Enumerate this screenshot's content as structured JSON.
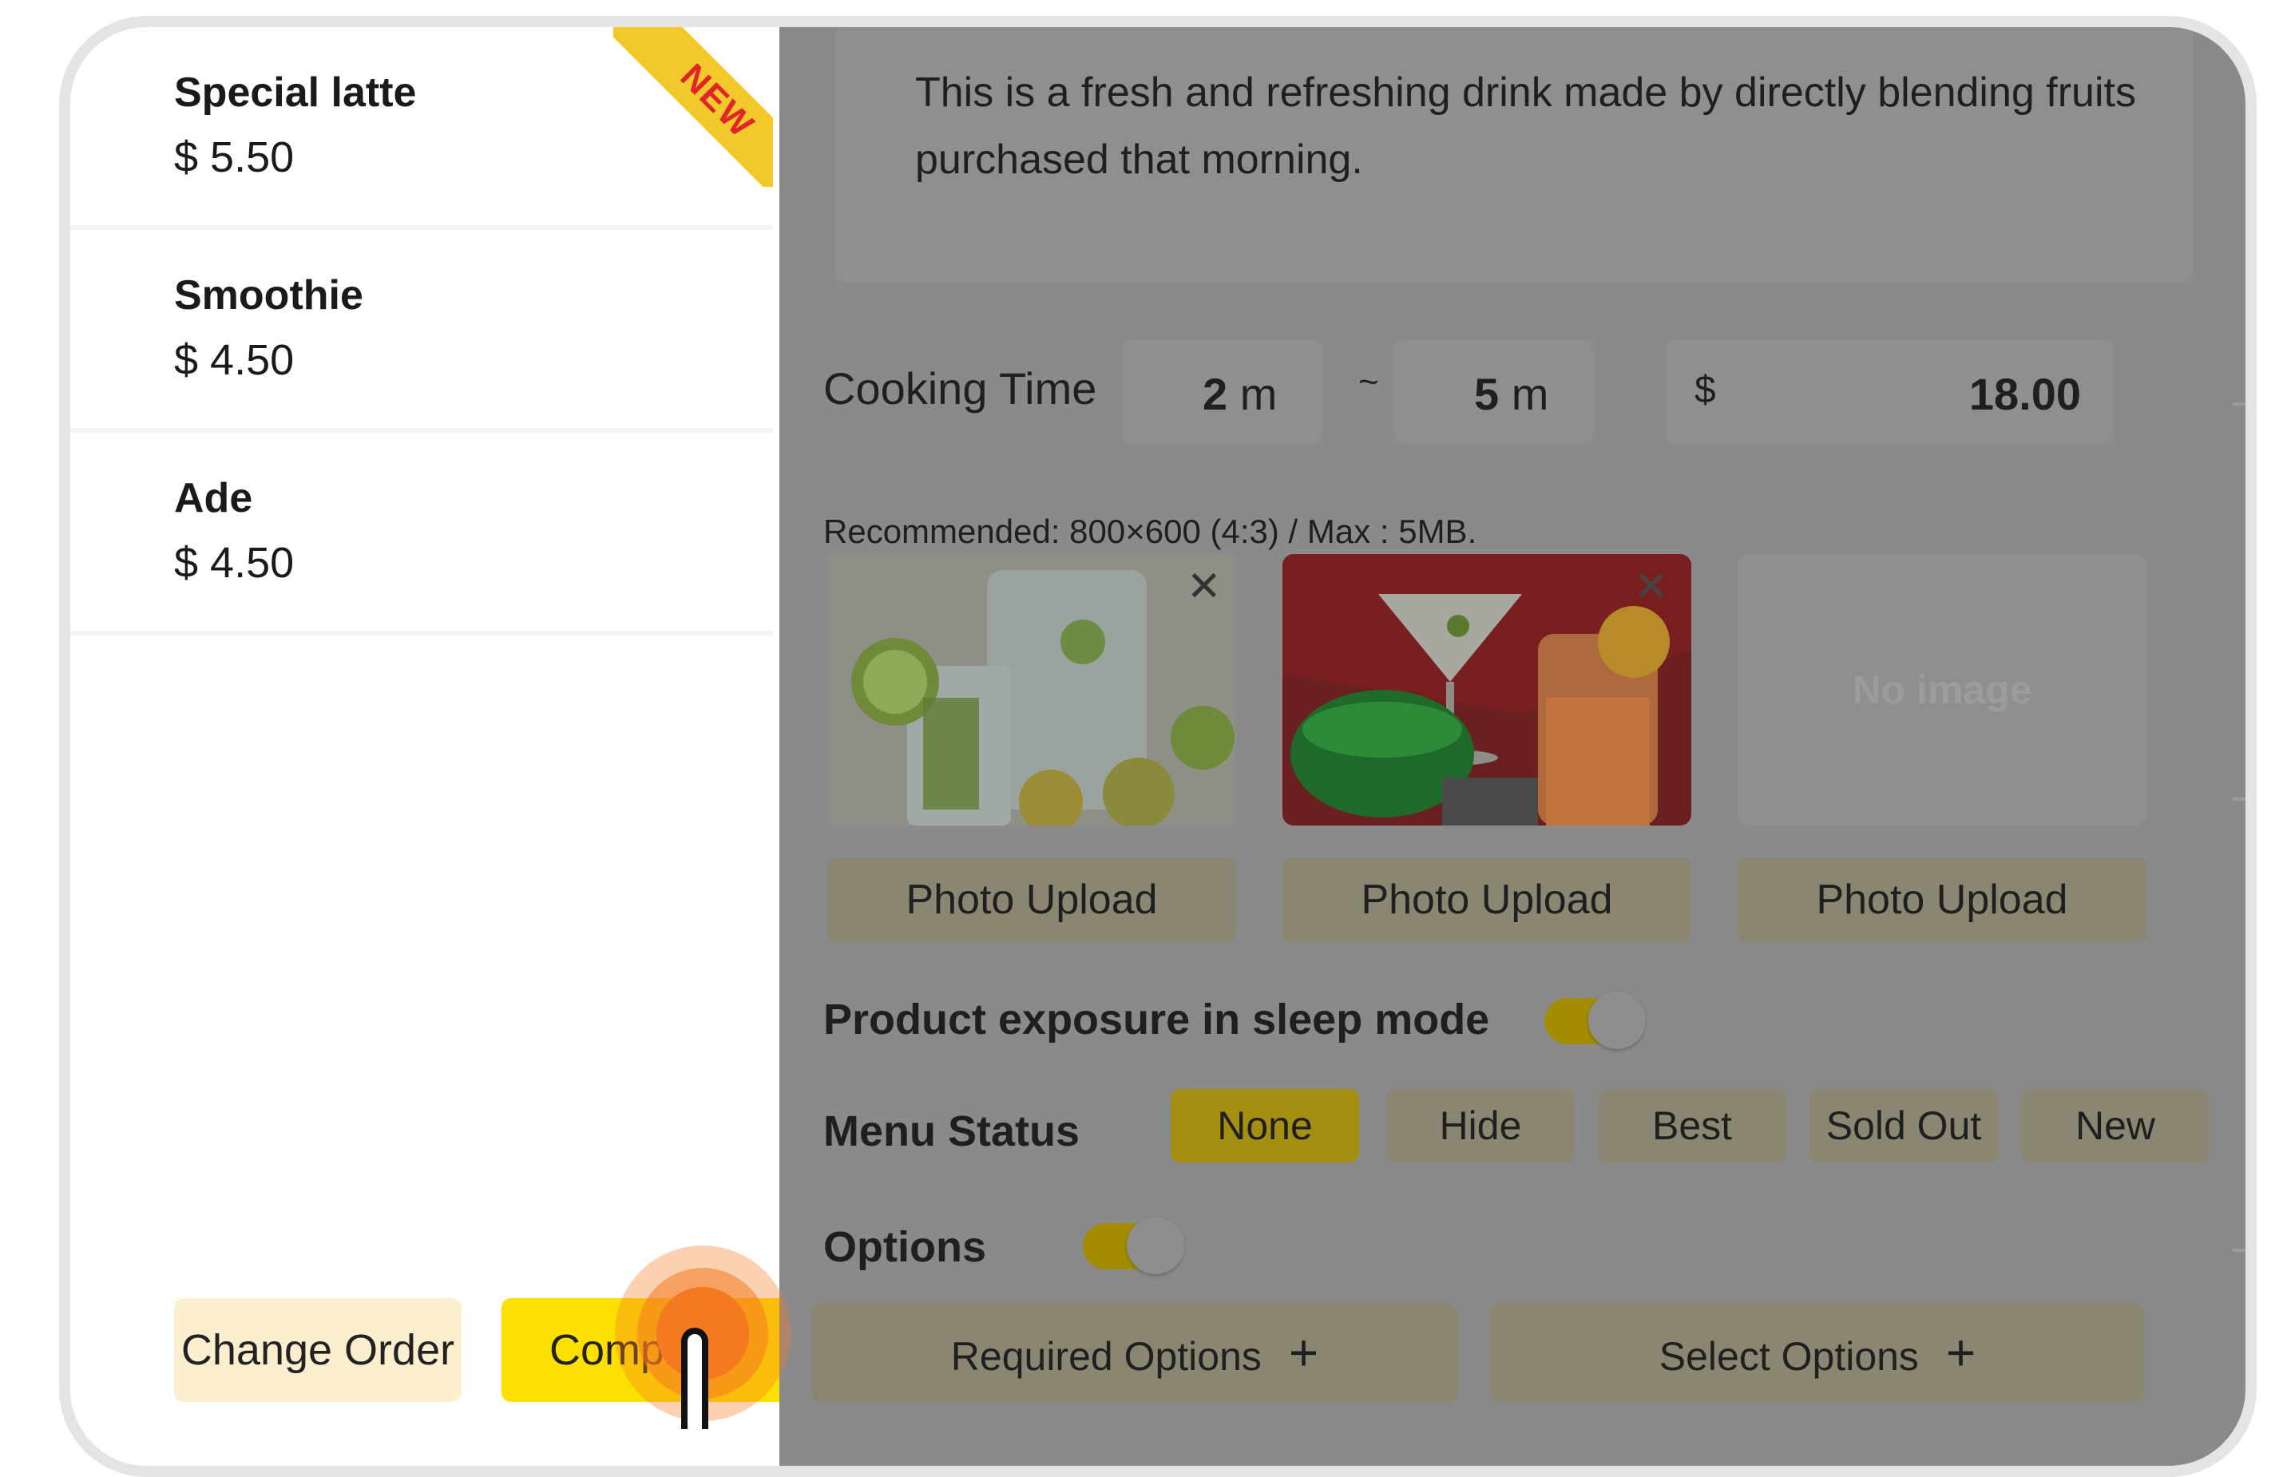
{
  "menu": {
    "items": [
      {
        "name": "Special latte",
        "price": "$ 5.50",
        "badge": "NEW"
      },
      {
        "name": "Smoothie",
        "price": "$ 4.50"
      },
      {
        "name": "Ade",
        "price": "$ 4.50"
      }
    ],
    "change_order_label": "Change Order",
    "complete_label": "Complete"
  },
  "detail": {
    "description": "This is a fresh and refreshing drink made by directly blending fruits purchased that morning.",
    "cooking_time_label": "Cooking Time",
    "cooking_min": "2",
    "cooking_max": "5",
    "minute_unit": "m",
    "range_sep": "~",
    "currency": "$",
    "price": "18.00",
    "image_hint": "Recommended: 800×600 (4:3) / Max : 5MB.",
    "no_image": "No image",
    "photo_upload_label": "Photo Upload",
    "sleep_mode_label": "Product exposure in sleep mode",
    "sleep_mode_on": true,
    "menu_status_label": "Menu Status",
    "status_options": [
      "None",
      "Hide",
      "Best",
      "Sold Out",
      "New"
    ],
    "status_selected": "None",
    "options_label": "Options",
    "options_on": true,
    "required_options_label": "Required Options",
    "select_options_label": "Select Options"
  },
  "colors": {
    "accent_yellow": "#fde000",
    "change_order_bg": "#fcefd0",
    "overlay_gray": "#8a8a8a",
    "tap_orange": "#f47a20"
  }
}
